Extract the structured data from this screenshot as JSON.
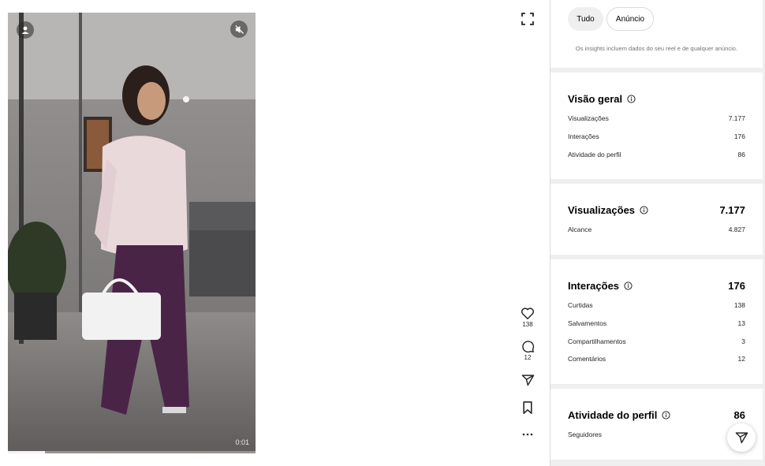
{
  "video": {
    "time": "0:01",
    "progress": 0.15
  },
  "actions": {
    "likes": "138",
    "comments": "12"
  },
  "filters": {
    "all": "Tudo",
    "ads": "Anúncio"
  },
  "note": "Os insights incluem dados do seu reel e de qualquer anúncio.",
  "overview": {
    "title": "Visão geral",
    "rows": [
      {
        "label": "Visualizações",
        "value": "7.177"
      },
      {
        "label": "Interações",
        "value": "176"
      },
      {
        "label": "Atividade do perfil",
        "value": "86"
      }
    ]
  },
  "views": {
    "title": "Visualizações",
    "total": "7.177",
    "rows": [
      {
        "label": "Alcance",
        "value": "4.827"
      }
    ]
  },
  "interactions": {
    "title": "Interações",
    "total": "176",
    "rows": [
      {
        "label": "Curtidas",
        "value": "138"
      },
      {
        "label": "Salvamentos",
        "value": "13"
      },
      {
        "label": "Compartilhamentos",
        "value": "3"
      },
      {
        "label": "Comentários",
        "value": "12"
      }
    ]
  },
  "profile": {
    "title": "Atividade do perfil",
    "total": "86",
    "rows": [
      {
        "label": "Seguidores",
        "value": ""
      }
    ]
  }
}
